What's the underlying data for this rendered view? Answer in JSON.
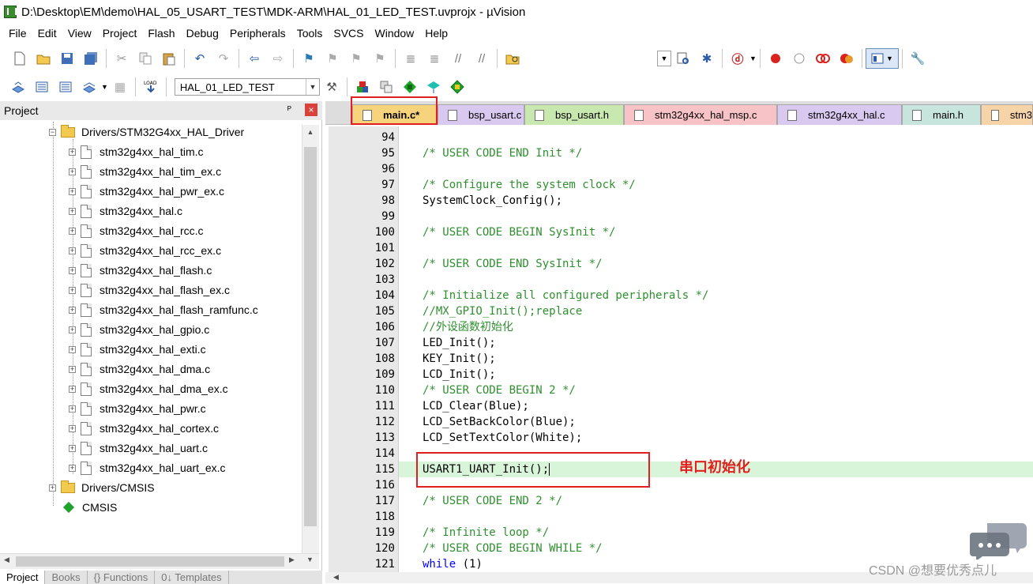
{
  "window": {
    "title": "D:\\Desktop\\EM\\demo\\HAL_05_USART_TEST\\MDK-ARM\\HAL_01_LED_TEST.uvprojx - µVision"
  },
  "menu": [
    "File",
    "Edit",
    "View",
    "Project",
    "Flash",
    "Debug",
    "Peripherals",
    "Tools",
    "SVCS",
    "Window",
    "Help"
  ],
  "toolbar": {
    "target_name": "HAL_01_LED_TEST"
  },
  "project_panel": {
    "title": "Project",
    "pin_glyph": "ᴾ",
    "close_glyph": "×",
    "group_label": "Drivers/STM32G4xx_HAL_Driver",
    "files": [
      "stm32g4xx_hal_tim.c",
      "stm32g4xx_hal_tim_ex.c",
      "stm32g4xx_hal_pwr_ex.c",
      "stm32g4xx_hal.c",
      "stm32g4xx_hal_rcc.c",
      "stm32g4xx_hal_rcc_ex.c",
      "stm32g4xx_hal_flash.c",
      "stm32g4xx_hal_flash_ex.c",
      "stm32g4xx_hal_flash_ramfunc.c",
      "stm32g4xx_hal_gpio.c",
      "stm32g4xx_hal_exti.c",
      "stm32g4xx_hal_dma.c",
      "stm32g4xx_hal_dma_ex.c",
      "stm32g4xx_hal_pwr.c",
      "stm32g4xx_hal_cortex.c",
      "stm32g4xx_hal_uart.c",
      "stm32g4xx_hal_uart_ex.c"
    ],
    "cmsis_group": "Drivers/CMSIS",
    "cmsis_component": "CMSIS",
    "bottom_tabs": [
      "Project",
      "Books",
      "{} Functions",
      "0↓ Templates"
    ]
  },
  "editor": {
    "tabs": [
      "main.c*",
      "bsp_usart.c",
      "bsp_usart.h",
      "stm32g4xx_hal_msp.c",
      "stm32g4xx_hal.c",
      "main.h",
      "stm3"
    ],
    "tab_colors": [
      "#f7d37c",
      "#d9c8ef",
      "#c9e8b0",
      "#f7c3c7",
      "#d9c8ef",
      "#c7e5dc",
      "#f7d3a8"
    ],
    "line_numbers": [
      "94",
      "95",
      "96",
      "97",
      "98",
      "99",
      "100",
      "101",
      "102",
      "103",
      "104",
      "105",
      "106",
      "107",
      "108",
      "109",
      "110",
      "111",
      "112",
      "113",
      "114",
      "115",
      "116",
      "117",
      "118",
      "119",
      "120",
      "121"
    ],
    "lines": [
      "",
      "/* USER CODE END Init */",
      "",
      "/* Configure the system clock */",
      "SystemClock_Config();",
      "",
      "/* USER CODE BEGIN SysInit */",
      "",
      "/* USER CODE END SysInit */",
      "",
      "/* Initialize all configured peripherals */",
      "//MX_GPIO_Init();replace",
      "//外设函数初始化",
      "LED_Init();",
      "KEY_Init();",
      "LCD_Init();",
      "/* USER CODE BEGIN 2 */",
      "LCD_Clear(Blue);",
      "LCD_SetBackColor(Blue);",
      "LCD_SetTextColor(White);",
      "",
      "USART1_UART_Init();",
      "",
      "/* USER CODE END 2 */",
      "",
      "/* Infinite loop */",
      "/* USER CODE BEGIN WHILE */",
      "while (1)"
    ],
    "annotation": "串口初始化"
  },
  "watermark": "CSDN @想要优秀点儿"
}
